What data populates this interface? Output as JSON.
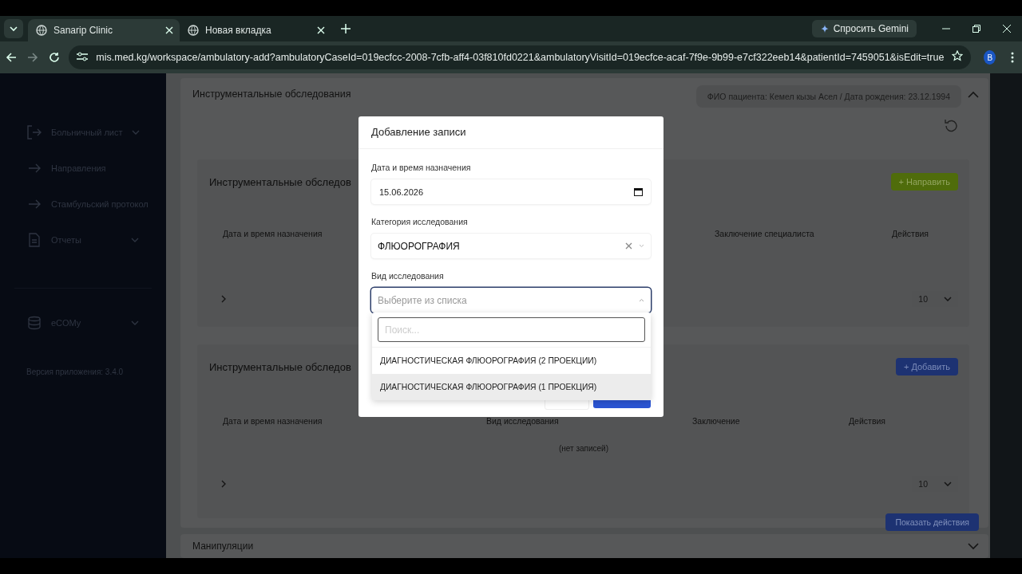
{
  "browser": {
    "tabs": [
      {
        "title": "Sanarip Clinic",
        "selected": true
      },
      {
        "title": "Новая вкладка",
        "selected": false
      }
    ],
    "gemini_button": "Спросить Gemini",
    "url": "mis.med.kg/workspace/ambulatory-add?ambulatoryCaseId=019ecfcc-2008-7cfb-aff4-03f810fd0221&ambulatoryVisitId=019ecfce-acaf-7f9e-9b99-e7cf322eeb14&patientId=7459051&isEdit=true",
    "profile": "B"
  },
  "sidebar": {
    "items": [
      {
        "label": "Больничный лист",
        "kind": "exit",
        "expandable": true
      },
      {
        "label": "Направления",
        "kind": "arrow",
        "expandable": false
      },
      {
        "label": "Стамбульский протокол",
        "kind": "arrow",
        "expandable": false
      },
      {
        "label": "Отчеты",
        "kind": "document",
        "expandable": true
      },
      {
        "label": "eCOMy",
        "kind": "database",
        "expandable": true
      }
    ],
    "version": "Версия приложения: 3.4.0"
  },
  "section": {
    "title": "Инструментальные обследования",
    "patient_info": "ФИО пациента: Кемел кызы Асел / Дата рождения: 23.12.1994"
  },
  "cards": [
    {
      "title": "Инструментальные обследов",
      "button": "+ Направить",
      "kind": "green",
      "columns": [
        "Дата и время назначения",
        "Заключение специалиста",
        "Действия"
      ],
      "page_size": "10"
    },
    {
      "title": "Инструментальные обследов",
      "button": "+ Добавить",
      "kind": "blue",
      "columns": [
        "Дата и время назначения",
        "Вид исследования",
        "Заключение",
        "Действия"
      ],
      "empty": "(нет записей)",
      "page_size": "10",
      "footer_button": "Показать действия"
    }
  ],
  "collapsed_section": "Манипуляции",
  "modal": {
    "title": "Добавление записи",
    "date_label": "Дата и время назначения",
    "date_value": "15.06.2026",
    "category_label": "Категория исследования",
    "category_value": "ФЛЮОРОГРАФИЯ",
    "type_label": "Вид исследования",
    "type_placeholder": "Выберите из списка",
    "dropdown": {
      "search_placeholder": "Поиск...",
      "options": [
        {
          "label": "ДИАГНОСТИЧЕСКАЯ ФЛЮОРОГРАФИЯ (2 ПРОЕКЦИИ)",
          "highlighted": false
        },
        {
          "label": "ДИАГНОСТИЧЕСКАЯ ФЛЮОРОГРАФИЯ (1 ПРОЕКЦИЯ)",
          "highlighted": true
        }
      ]
    }
  }
}
